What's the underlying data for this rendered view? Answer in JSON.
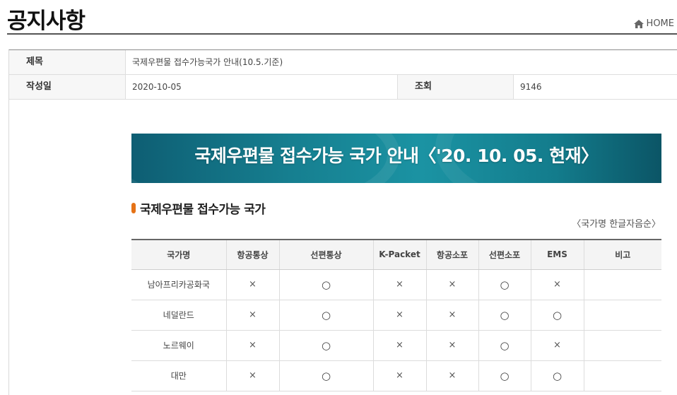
{
  "header": {
    "title": "공지사항",
    "home_label": "HOME"
  },
  "notice": {
    "title_label": "제목",
    "title_value": "국제우편물 접수가능국가 안내(10.5.기준)",
    "date_label": "작성일",
    "date_value": "2020-10-05",
    "views_label": "조회",
    "views_value": "9146"
  },
  "banner": {
    "text": "국제우편물 접수가능 국가 안내〈'20. 10. 05. 현재〉"
  },
  "section": {
    "heading": "국제우편물 접수가능 국가",
    "order_note": "〈국가명 한글자음순〉"
  },
  "table": {
    "headers": [
      "국가명",
      "항공통상",
      "선편통상",
      "K-Packet",
      "항공소포",
      "선편소포",
      "EMS",
      "비고"
    ],
    "rows": [
      [
        "남아프리카공화국",
        "×",
        "○",
        "×",
        "×",
        "○",
        "×",
        ""
      ],
      [
        "네덜란드",
        "×",
        "○",
        "×",
        "×",
        "○",
        "○",
        ""
      ],
      [
        "노르웨이",
        "×",
        "○",
        "×",
        "×",
        "○",
        "×",
        ""
      ],
      [
        "대만",
        "×",
        "○",
        "×",
        "×",
        "○",
        "○",
        ""
      ]
    ]
  },
  "icons": {
    "home": "home-icon"
  }
}
